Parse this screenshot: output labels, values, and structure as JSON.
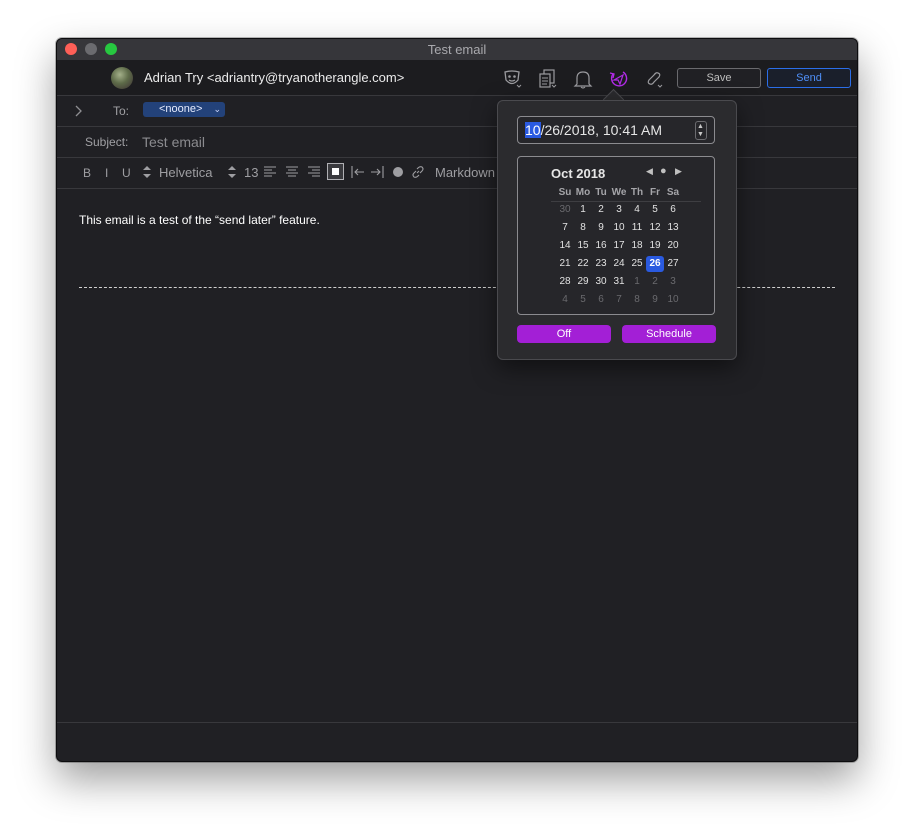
{
  "window": {
    "title": "Test email"
  },
  "header": {
    "from": "Adrian Try <adriantry@tryanotherangle.com>",
    "save_label": "Save",
    "send_label": "Send"
  },
  "compose": {
    "to_label": "To:",
    "to_recipient": "<noone>",
    "subject_label": "Subject:",
    "subject_value": "Test email",
    "body_text": "This email is a test of the “send later” feature."
  },
  "format_bar": {
    "bold": "B",
    "italic": "I",
    "underline": "U",
    "font_name": "Helvetica",
    "font_size": "13",
    "markdown": "Markdown"
  },
  "schedule_popover": {
    "datetime_selected": "10",
    "datetime_rest": "/26/2018, 10:41 AM",
    "calendar": {
      "month_label": "Oct 2018",
      "weekdays": [
        "Su",
        "Mo",
        "Tu",
        "We",
        "Th",
        "Fr",
        "Sa"
      ],
      "weeks": [
        [
          "30",
          "1",
          "2",
          "3",
          "4",
          "5",
          "6"
        ],
        [
          "7",
          "8",
          "9",
          "10",
          "11",
          "12",
          "13"
        ],
        [
          "14",
          "15",
          "16",
          "17",
          "18",
          "19",
          "20"
        ],
        [
          "21",
          "22",
          "23",
          "24",
          "25",
          "26",
          "27"
        ],
        [
          "28",
          "29",
          "30",
          "31",
          "1",
          "2",
          "3"
        ],
        [
          "4",
          "5",
          "6",
          "7",
          "8",
          "9",
          "10"
        ]
      ],
      "selected_day": "26"
    },
    "off_label": "Off",
    "schedule_label": "Schedule",
    "accent_color": "#a31fd6"
  }
}
